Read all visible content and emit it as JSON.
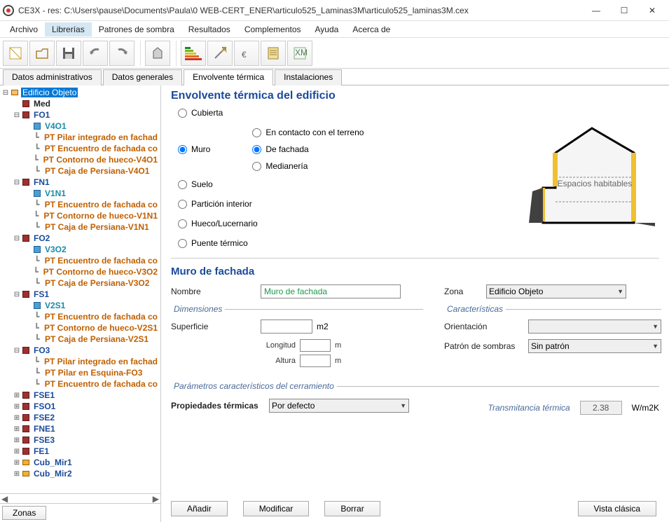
{
  "title": "CE3X - res: C:\\Users\\pause\\Documents\\Paula\\0 WEB-CERT_ENER\\articulo525_Laminas3M\\articulo525_laminas3M.cex",
  "menu": {
    "items": [
      "Archivo",
      "Librerías",
      "Patrones de sombra",
      "Resultados",
      "Complementos",
      "Ayuda",
      "Acerca de"
    ],
    "active": 1
  },
  "tabs": {
    "items": [
      "Datos administrativos",
      "Datos generales",
      "Envolvente térmica",
      "Instalaciones"
    ],
    "active": 2
  },
  "tree": [
    {
      "d": 0,
      "t": "m",
      "i": "home",
      "l": "Edificio Objeto",
      "sel": true,
      "cls": ""
    },
    {
      "d": 1,
      "t": "",
      "i": "wall",
      "l": "Med",
      "cls": "c-black"
    },
    {
      "d": 1,
      "t": "m",
      "i": "wall",
      "l": "FO1",
      "cls": "c-blue"
    },
    {
      "d": 2,
      "t": "",
      "i": "win",
      "l": "V4O1",
      "cls": "c-teal"
    },
    {
      "d": 2,
      "t": "",
      "i": "",
      "l": "PT Pilar integrado en fachad",
      "cls": "c-orange"
    },
    {
      "d": 2,
      "t": "",
      "i": "",
      "l": "PT Encuentro de fachada co",
      "cls": "c-orange"
    },
    {
      "d": 2,
      "t": "",
      "i": "",
      "l": "PT Contorno de hueco-V4O1",
      "cls": "c-orange"
    },
    {
      "d": 2,
      "t": "",
      "i": "",
      "l": "PT Caja de Persiana-V4O1",
      "cls": "c-orange"
    },
    {
      "d": 1,
      "t": "m",
      "i": "wall",
      "l": "FN1",
      "cls": "c-blue"
    },
    {
      "d": 2,
      "t": "",
      "i": "win",
      "l": "V1N1",
      "cls": "c-teal"
    },
    {
      "d": 2,
      "t": "",
      "i": "",
      "l": "PT Encuentro de fachada co",
      "cls": "c-orange"
    },
    {
      "d": 2,
      "t": "",
      "i": "",
      "l": "PT Contorno de hueco-V1N1",
      "cls": "c-orange"
    },
    {
      "d": 2,
      "t": "",
      "i": "",
      "l": "PT Caja de Persiana-V1N1",
      "cls": "c-orange"
    },
    {
      "d": 1,
      "t": "m",
      "i": "wall",
      "l": "FO2",
      "cls": "c-blue"
    },
    {
      "d": 2,
      "t": "",
      "i": "win",
      "l": "V3O2",
      "cls": "c-teal"
    },
    {
      "d": 2,
      "t": "",
      "i": "",
      "l": "PT Encuentro de fachada co",
      "cls": "c-orange"
    },
    {
      "d": 2,
      "t": "",
      "i": "",
      "l": "PT Contorno de hueco-V3O2",
      "cls": "c-orange"
    },
    {
      "d": 2,
      "t": "",
      "i": "",
      "l": "PT Caja de Persiana-V3O2",
      "cls": "c-orange"
    },
    {
      "d": 1,
      "t": "m",
      "i": "wall",
      "l": "FS1",
      "cls": "c-blue"
    },
    {
      "d": 2,
      "t": "",
      "i": "win",
      "l": "V2S1",
      "cls": "c-teal"
    },
    {
      "d": 2,
      "t": "",
      "i": "",
      "l": "PT Encuentro de fachada co",
      "cls": "c-orange"
    },
    {
      "d": 2,
      "t": "",
      "i": "",
      "l": "PT Contorno de hueco-V2S1",
      "cls": "c-orange"
    },
    {
      "d": 2,
      "t": "",
      "i": "",
      "l": "PT Caja de Persiana-V2S1",
      "cls": "c-orange"
    },
    {
      "d": 1,
      "t": "m",
      "i": "wall",
      "l": "FO3",
      "cls": "c-blue"
    },
    {
      "d": 2,
      "t": "",
      "i": "",
      "l": "PT Pilar integrado en fachad",
      "cls": "c-orange"
    },
    {
      "d": 2,
      "t": "",
      "i": "",
      "l": "PT Pilar en Esquina-FO3",
      "cls": "c-orange"
    },
    {
      "d": 2,
      "t": "",
      "i": "",
      "l": "PT Encuentro de fachada co",
      "cls": "c-orange"
    },
    {
      "d": 1,
      "t": "p",
      "i": "wall",
      "l": "FSE1",
      "cls": "c-blue"
    },
    {
      "d": 1,
      "t": "p",
      "i": "wall",
      "l": "FSO1",
      "cls": "c-blue"
    },
    {
      "d": 1,
      "t": "p",
      "i": "wall",
      "l": "FSE2",
      "cls": "c-blue"
    },
    {
      "d": 1,
      "t": "p",
      "i": "wall",
      "l": "FNE1",
      "cls": "c-blue"
    },
    {
      "d": 1,
      "t": "p",
      "i": "wall",
      "l": "FSE3",
      "cls": "c-blue"
    },
    {
      "d": 1,
      "t": "p",
      "i": "wall",
      "l": "FE1",
      "cls": "c-blue"
    },
    {
      "d": 1,
      "t": "p",
      "i": "roof",
      "l": "Cub_Mir1",
      "cls": "c-blue"
    },
    {
      "d": 1,
      "t": "p",
      "i": "roof",
      "l": "Cub_Mir2",
      "cls": "c-blue"
    }
  ],
  "sidebar_footer": {
    "zonas": "Zonas"
  },
  "content": {
    "title": "Envolvente térmica del edificio",
    "radios_left": [
      "Cubierta",
      "Muro",
      "Suelo",
      "Partición interior",
      "Hueco/Lucernario",
      "Puente térmico"
    ],
    "radios_left_sel": 1,
    "radios_right": [
      "En contacto con el terreno",
      "De fachada",
      "Medianería"
    ],
    "radios_right_sel": 1,
    "diagram_label": "Espacios habitables",
    "subtitle": "Muro de fachada",
    "nombre_lbl": "Nombre",
    "nombre_val": "Muro de fachada",
    "zona_lbl": "Zona",
    "zona_val": "Edificio Objeto",
    "dimensiones": "Dimensiones",
    "superficie_lbl": "Superficie",
    "superficie_unit": "m2",
    "longitud_lbl": "Longitud",
    "longitud_unit": "m",
    "altura_lbl": "Altura",
    "altura_unit": "m",
    "caracteristicas": "Características",
    "orientacion_lbl": "Orientación",
    "orientacion_val": "",
    "patron_lbl": "Patrón de sombras",
    "patron_val": "Sin patrón",
    "parametros": "Parámetros característicos del cerramiento",
    "prop_lbl": "Propiedades térmicas",
    "prop_val": "Por defecto",
    "trans_lbl": "Transmitancia térmica",
    "trans_val": "2.38",
    "trans_unit": "W/m2K",
    "buttons": {
      "anadir": "Añadir",
      "modificar": "Modificar",
      "borrar": "Borrar",
      "vista": "Vista clásica"
    }
  }
}
